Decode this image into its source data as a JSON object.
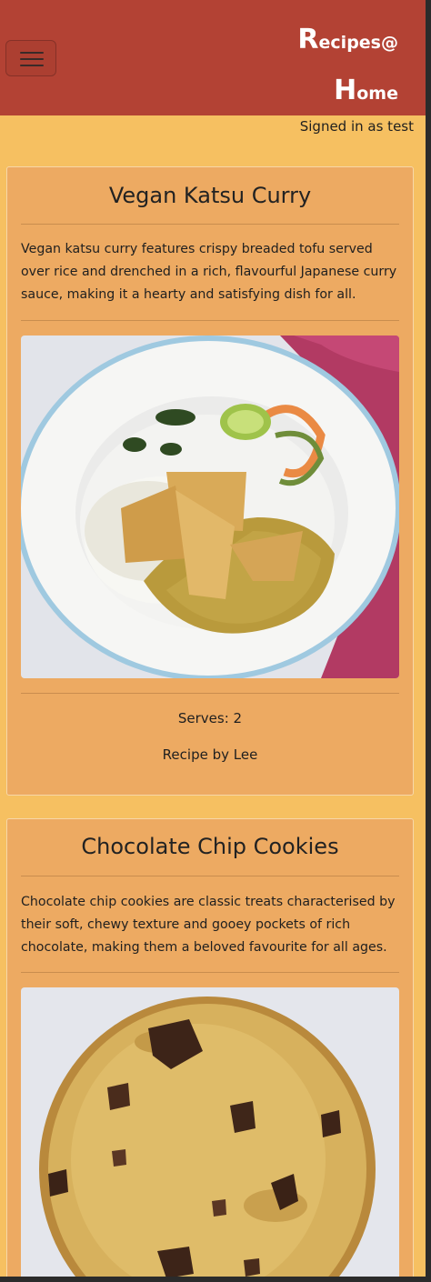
{
  "brand": {
    "part1_initial": "R",
    "part1_rest": "ecipes@",
    "part2_initial": "H",
    "part2_rest": "ome"
  },
  "menu_toggle": {
    "icon": "hamburger-menu-icon"
  },
  "user_status": "Signed in as test",
  "colors": {
    "navbar": "#b34234",
    "page_bg": "#f6c061",
    "card_bg": "#edaa62"
  },
  "recipes": [
    {
      "title": "Vegan Katsu Curry",
      "description": "Vegan katsu curry features crispy breaded tofu served over rice and drenched in a rich, flavourful Japanese curry sauce, making it a hearty and satisfying dish for all.",
      "image": "katsu-curry-photo",
      "serves": "Serves: 2",
      "author": "Recipe by Lee"
    },
    {
      "title": "Chocolate Chip Cookies",
      "description": "Chocolate chip cookies are classic treats characterised by their soft, chewy texture and gooey pockets of rich chocolate, making them a beloved favourite for all ages.",
      "image": "chocolate-chip-cookie-photo"
    }
  ]
}
